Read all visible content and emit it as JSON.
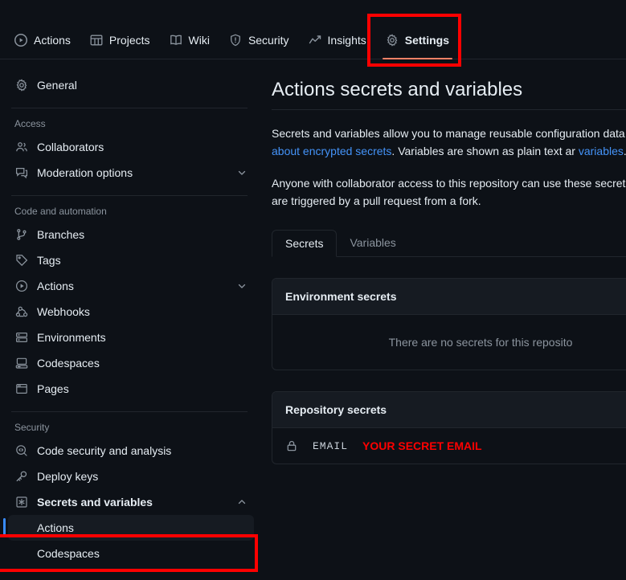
{
  "colors": {
    "background": "#0d1117",
    "surface": "#161b22",
    "border": "#21262d",
    "text": "#e6edf3",
    "muted": "#8b949e",
    "link": "#4493f8",
    "accent_underline": "#f78166",
    "selected_indicator": "#388bfd",
    "annotation": "#ff0000",
    "secret_value": "#ff0000"
  },
  "repo_nav": {
    "tabs": [
      {
        "label": "Actions",
        "icon": "play-circle-icon",
        "active": false
      },
      {
        "label": "Projects",
        "icon": "table-icon",
        "active": false
      },
      {
        "label": "Wiki",
        "icon": "book-icon",
        "active": false
      },
      {
        "label": "Security",
        "icon": "shield-icon",
        "active": false
      },
      {
        "label": "Insights",
        "icon": "graph-icon",
        "active": false
      },
      {
        "label": "Settings",
        "icon": "gear-icon",
        "active": true
      }
    ]
  },
  "sidebar": {
    "top_items": [
      {
        "label": "General",
        "icon": "gear-icon"
      }
    ],
    "sections": [
      {
        "title": "Access",
        "items": [
          {
            "label": "Collaborators",
            "icon": "people-icon",
            "chevron": null
          },
          {
            "label": "Moderation options",
            "icon": "comment-icon",
            "chevron": "down"
          }
        ]
      },
      {
        "title": "Code and automation",
        "items": [
          {
            "label": "Branches",
            "icon": "git-branch-icon",
            "chevron": null
          },
          {
            "label": "Tags",
            "icon": "tag-icon",
            "chevron": null
          },
          {
            "label": "Actions",
            "icon": "play-circle-icon",
            "chevron": "down"
          },
          {
            "label": "Webhooks",
            "icon": "webhook-icon",
            "chevron": null
          },
          {
            "label": "Environments",
            "icon": "server-icon",
            "chevron": null
          },
          {
            "label": "Codespaces",
            "icon": "codespaces-icon",
            "chevron": null
          },
          {
            "label": "Pages",
            "icon": "browser-icon",
            "chevron": null
          }
        ]
      },
      {
        "title": "Security",
        "items": [
          {
            "label": "Code security and analysis",
            "icon": "codescan-icon",
            "chevron": null
          },
          {
            "label": "Deploy keys",
            "icon": "key-icon",
            "chevron": null
          },
          {
            "label": "Secrets and variables",
            "icon": "asterisk-icon",
            "chevron": "up",
            "bold": true
          }
        ]
      }
    ],
    "sub_items": [
      {
        "label": "Actions",
        "selected": true
      },
      {
        "label": "Codespaces",
        "selected": false
      }
    ]
  },
  "main": {
    "title": "Actions secrets and variables",
    "paragraph1_before_link": "Secrets and variables allow you to manage reusable configuration data. S",
    "paragraph1_link1": "Learn more about encrypted secrets",
    "paragraph1_mid": ". Variables are shown as plain text ar",
    "paragraph1_link2": "variables",
    "paragraph1_after": ".",
    "paragraph2": "Anyone with collaborator access to this repository can use these secrets workflows that are triggered by a pull request from a fork.",
    "tabs": [
      {
        "label": "Secrets",
        "active": true
      },
      {
        "label": "Variables",
        "active": false
      }
    ],
    "environment_secrets": {
      "header": "Environment secrets",
      "empty_message": "There are no secrets for this reposito"
    },
    "repository_secrets": {
      "header": "Repository secrets",
      "rows": [
        {
          "icon": "lock-icon",
          "name": "EMAIL",
          "value": "YOUR SECRET EMAIL"
        }
      ]
    }
  }
}
